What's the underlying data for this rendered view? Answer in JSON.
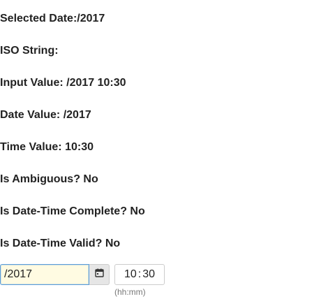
{
  "info": {
    "selected_date": "Selected Date:/2017",
    "iso_string": "ISO String:",
    "input_value": "Input Value: /2017 10:30",
    "date_value": "Date Value: /2017",
    "time_value": "Time Value: 10:30",
    "is_ambiguous": "Is Ambiguous? No",
    "is_complete": "Is Date-Time Complete? No",
    "is_valid": "Is Date-Time Valid? No"
  },
  "date_field": {
    "value": "/2017",
    "calendar_icon": "calendar-icon"
  },
  "time_field": {
    "hours": "10",
    "separator": ":",
    "minutes": "30",
    "hint": "(hh:mm)"
  },
  "colors": {
    "date_focus_border": "#5b9dd9",
    "date_background": "#fffbe2",
    "button_background": "#e6e6e6"
  }
}
